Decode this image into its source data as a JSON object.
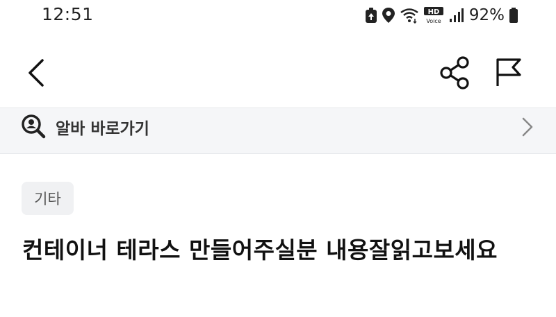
{
  "status_bar": {
    "time": "12:51",
    "battery": "92%",
    "icons": [
      "battery-saver-icon",
      "location-icon",
      "wifi-icon",
      "hd-voice-icon",
      "signal-icon",
      "battery-icon"
    ],
    "hd_voice_text": "HD",
    "hd_voice_sub": "Voice"
  },
  "app_bar": {
    "icons": [
      "back-arrow-icon",
      "share-icon",
      "flag-icon"
    ]
  },
  "alba_banner": {
    "label": "알바 바로가기",
    "icons": [
      "search-person-icon",
      "chevron-right-icon"
    ]
  },
  "post": {
    "category": "기타",
    "title": "컨테이너 테라스 만들어주실분 내용잘읽고보세요"
  }
}
